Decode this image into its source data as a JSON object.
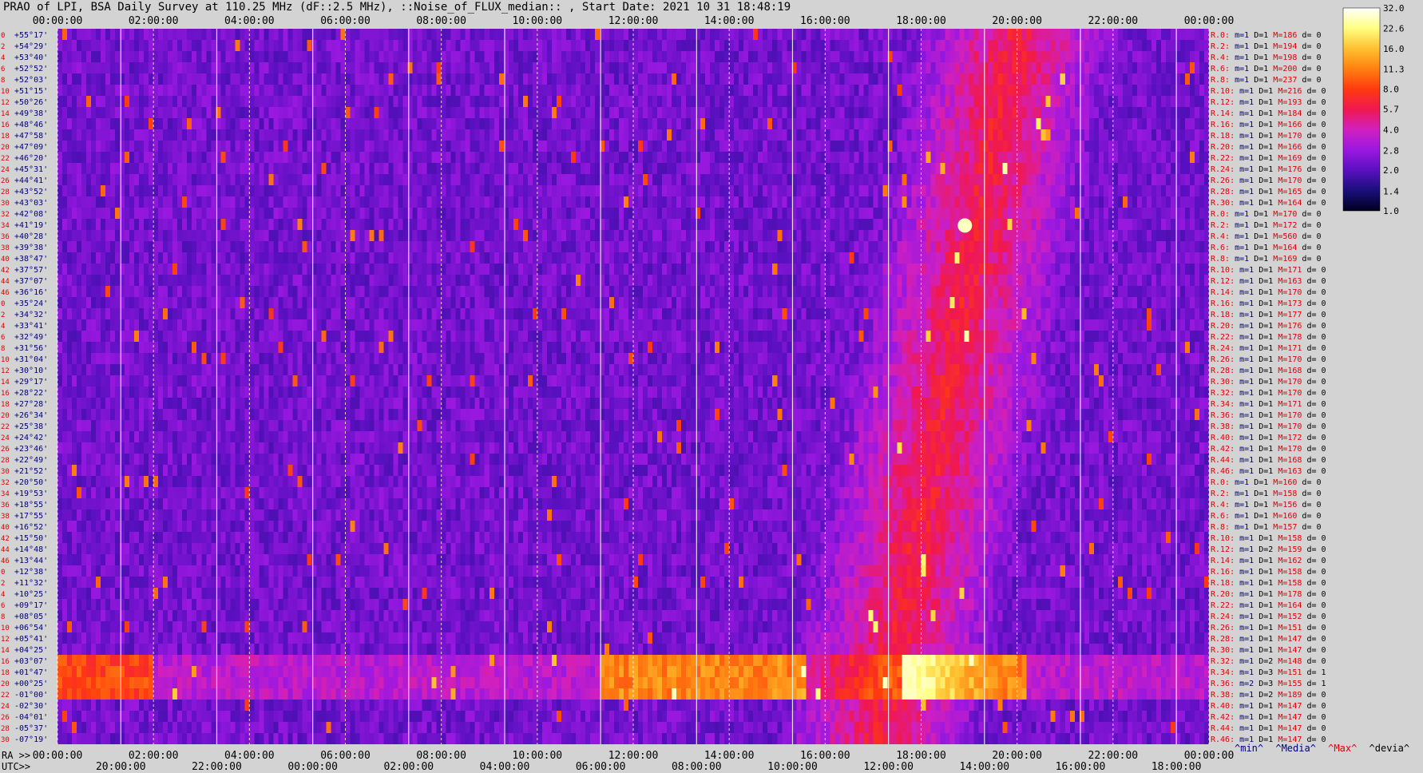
{
  "title": "PRAO of LPI, BSA Daily Survey at 110.25 MHz (dF::2.5 MHz), ::Noise_of_FLUX_median:: , Start Date: 2021 10 31 18:48:19",
  "axis_labels": {
    "ra": "RA >>",
    "utc": "UTC>>"
  },
  "footer_legend": {
    "min": "^min^",
    "median": "^Media^",
    "max": "^Max^",
    "devia": "^devia^"
  },
  "colors": {
    "background": "#d3d3d3",
    "right_label_red": "#e00000",
    "right_label_blue": "#00007a"
  },
  "chart_data": {
    "type": "heatmap",
    "top_x_ticks": [
      "00:00:00",
      "02:00:00",
      "04:00:00",
      "06:00:00",
      "08:00:00",
      "10:00:00",
      "12:00:00",
      "14:00:00",
      "16:00:00",
      "18:00:00",
      "20:00:00",
      "22:00:00",
      "00:00:00"
    ],
    "ra_ticks": [
      "00:00:00",
      "02:00:00",
      "04:00:00",
      "06:00:00",
      "08:00:00",
      "10:00:00",
      "12:00:00",
      "14:00:00",
      "16:00:00",
      "18:00:00",
      "20:00:00",
      "22:00:00",
      "00:00:00"
    ],
    "utc_ticks": [
      "20:00:00",
      "22:00:00",
      "00:00:00",
      "02:00:00",
      "04:00:00",
      "06:00:00",
      "08:00:00",
      "10:00:00",
      "12:00:00",
      "14:00:00",
      "16:00:00",
      "18:00:00"
    ],
    "row_numbers": [
      "0",
      "2",
      "4",
      "6",
      "8",
      "10",
      "12",
      "14",
      "16",
      "18",
      "20",
      "22",
      "24",
      "26",
      "28",
      "30",
      "32",
      "34",
      "36",
      "38",
      "40",
      "42",
      "44",
      "46",
      "0",
      "2",
      "4",
      "6",
      "8",
      "10",
      "12",
      "14",
      "16",
      "18",
      "20",
      "22",
      "24",
      "26",
      "28",
      "30",
      "32",
      "34",
      "36",
      "38",
      "40",
      "42",
      "44",
      "46",
      "0",
      "2",
      "4",
      "6",
      "8",
      "10",
      "12",
      "14",
      "16",
      "18",
      "20",
      "22",
      "24",
      "26",
      "28",
      "30",
      "32",
      "34",
      "36",
      "38",
      "40",
      "42",
      "44",
      "46"
    ],
    "declinations": [
      "+55°17'",
      "+54°29'",
      "+53°40'",
      "+52°52'",
      "+52°03'",
      "+51°15'",
      "+50°26'",
      "+49°38'",
      "+48°46'",
      "+47°58'",
      "+47°09'",
      "+46°20'",
      "+45°31'",
      "+44°41'",
      "+43°52'",
      "+43°03'",
      "+42°08'",
      "+41°19'",
      "+40°28'",
      "+39°38'",
      "+38°47'",
      "+37°57'",
      "+37°07'",
      "+36°16'",
      "+35°24'",
      "+34°32'",
      "+33°41'",
      "+32°49'",
      "+31°56'",
      "+31°04'",
      "+30°10'",
      "+29°17'",
      "+28°22'",
      "+27°28'",
      "+26°34'",
      "+25°38'",
      "+24°42'",
      "+23°46'",
      "+22°49'",
      "+21°52'",
      "+20°50'",
      "+19°53'",
      "+18°55'",
      "+17°55'",
      "+16°52'",
      "+15°50'",
      "+14°48'",
      "+13°44'",
      "+12°38'",
      "+11°32'",
      "+10°25'",
      "+09°17'",
      "+08°05'",
      "+06°54'",
      "+05°41'",
      "+04°25'",
      "+03°07'",
      "+01°47'",
      "+00°25'",
      "-01°00'",
      "-02°30'",
      "-04°01'",
      "-05°37'",
      "-07°19'"
    ],
    "right_labels": [
      {
        "r": "R.0:",
        "m": "m=1",
        "d": "D=1",
        "mm": "M=186",
        "dd": "d= 0"
      },
      {
        "r": "R.2:",
        "m": "m=1",
        "d": "D=1",
        "mm": "M=194",
        "dd": "d= 0"
      },
      {
        "r": "R.4:",
        "m": "m=1",
        "d": "D=1",
        "mm": "M=198",
        "dd": "d= 0"
      },
      {
        "r": "R.6:",
        "m": "m=1",
        "d": "D=1",
        "mm": "M=200",
        "dd": "d= 0"
      },
      {
        "r": "R.8:",
        "m": "m=1",
        "d": "D=1",
        "mm": "M=237",
        "dd": "d= 0"
      },
      {
        "r": "R.10:",
        "m": "m=1",
        "d": "D=1",
        "mm": "M=216",
        "dd": "d= 0"
      },
      {
        "r": "R.12:",
        "m": "m=1",
        "d": "D=1",
        "mm": "M=193",
        "dd": "d= 0"
      },
      {
        "r": "R.14:",
        "m": "m=1",
        "d": "D=1",
        "mm": "M=184",
        "dd": "d= 0"
      },
      {
        "r": "R.16:",
        "m": "m=1",
        "d": "D=1",
        "mm": "M=166",
        "dd": "d= 0"
      },
      {
        "r": "R.18:",
        "m": "m=1",
        "d": "D=1",
        "mm": "M=170",
        "dd": "d= 0"
      },
      {
        "r": "R.20:",
        "m": "m=1",
        "d": "D=1",
        "mm": "M=166",
        "dd": "d= 0"
      },
      {
        "r": "R.22:",
        "m": "m=1",
        "d": "D=1",
        "mm": "M=169",
        "dd": "d= 0"
      },
      {
        "r": "R.24:",
        "m": "m=1",
        "d": "D=1",
        "mm": "M=176",
        "dd": "d= 0"
      },
      {
        "r": "R.26:",
        "m": "m=1",
        "d": "D=1",
        "mm": "M=170",
        "dd": "d= 0"
      },
      {
        "r": "R.28:",
        "m": "m=1",
        "d": "D=1",
        "mm": "M=165",
        "dd": "d= 0"
      },
      {
        "r": "R.30:",
        "m": "m=1",
        "d": "D=1",
        "mm": "M=164",
        "dd": "d= 0"
      },
      {
        "r": "R.0:",
        "m": "m=1",
        "d": "D=1",
        "mm": "M=170",
        "dd": "d= 0"
      },
      {
        "r": "R.2:",
        "m": "m=1",
        "d": "D=1",
        "mm": "M=172",
        "dd": "d= 0"
      },
      {
        "r": "R.4:",
        "m": "m=1",
        "d": "D=1",
        "mm": "M=560",
        "dd": "d= 0"
      },
      {
        "r": "R.6:",
        "m": "m=1",
        "d": "D=1",
        "mm": "M=164",
        "dd": "d= 0"
      },
      {
        "r": "R.8:",
        "m": "m=1",
        "d": "D=1",
        "mm": "M=169",
        "dd": "d= 0"
      },
      {
        "r": "R.10:",
        "m": "m=1",
        "d": "D=1",
        "mm": "M=171",
        "dd": "d= 0"
      },
      {
        "r": "R.12:",
        "m": "m=1",
        "d": "D=1",
        "mm": "M=163",
        "dd": "d= 0"
      },
      {
        "r": "R.14:",
        "m": "m=1",
        "d": "D=1",
        "mm": "M=170",
        "dd": "d= 0"
      },
      {
        "r": "R.16:",
        "m": "m=1",
        "d": "D=1",
        "mm": "M=173",
        "dd": "d= 0"
      },
      {
        "r": "R.18:",
        "m": "m=1",
        "d": "D=1",
        "mm": "M=177",
        "dd": "d= 0"
      },
      {
        "r": "R.20:",
        "m": "m=1",
        "d": "D=1",
        "mm": "M=176",
        "dd": "d= 0"
      },
      {
        "r": "R.22:",
        "m": "m=1",
        "d": "D=1",
        "mm": "M=178",
        "dd": "d= 0"
      },
      {
        "r": "R.24:",
        "m": "m=1",
        "d": "D=1",
        "mm": "M=171",
        "dd": "d= 0"
      },
      {
        "r": "R.26:",
        "m": "m=1",
        "d": "D=1",
        "mm": "M=170",
        "dd": "d= 0"
      },
      {
        "r": "R.28:",
        "m": "m=1",
        "d": "D=1",
        "mm": "M=168",
        "dd": "d= 0"
      },
      {
        "r": "R.30:",
        "m": "m=1",
        "d": "D=1",
        "mm": "M=170",
        "dd": "d= 0"
      },
      {
        "r": "R.32:",
        "m": "m=1",
        "d": "D=1",
        "mm": "M=170",
        "dd": "d= 0"
      },
      {
        "r": "R.34:",
        "m": "m=1",
        "d": "D=1",
        "mm": "M=171",
        "dd": "d= 0"
      },
      {
        "r": "R.36:",
        "m": "m=1",
        "d": "D=1",
        "mm": "M=170",
        "dd": "d= 0"
      },
      {
        "r": "R.38:",
        "m": "m=1",
        "d": "D=1",
        "mm": "M=170",
        "dd": "d= 0"
      },
      {
        "r": "R.40:",
        "m": "m=1",
        "d": "D=1",
        "mm": "M=172",
        "dd": "d= 0"
      },
      {
        "r": "R.42:",
        "m": "m=1",
        "d": "D=1",
        "mm": "M=170",
        "dd": "d= 0"
      },
      {
        "r": "R.44:",
        "m": "m=1",
        "d": "D=1",
        "mm": "M=168",
        "dd": "d= 0"
      },
      {
        "r": "R.46:",
        "m": "m=1",
        "d": "D=1",
        "mm": "M=163",
        "dd": "d= 0"
      },
      {
        "r": "R.0:",
        "m": "m=1",
        "d": "D=1",
        "mm": "M=160",
        "dd": "d= 0"
      },
      {
        "r": "R.2:",
        "m": "m=1",
        "d": "D=1",
        "mm": "M=158",
        "dd": "d= 0"
      },
      {
        "r": "R.4:",
        "m": "m=1",
        "d": "D=1",
        "mm": "M=156",
        "dd": "d= 0"
      },
      {
        "r": "R.6:",
        "m": "m=1",
        "d": "D=1",
        "mm": "M=160",
        "dd": "d= 0"
      },
      {
        "r": "R.8:",
        "m": "m=1",
        "d": "D=1",
        "mm": "M=157",
        "dd": "d= 0"
      },
      {
        "r": "R.10:",
        "m": "m=1",
        "d": "D=1",
        "mm": "M=158",
        "dd": "d= 0"
      },
      {
        "r": "R.12:",
        "m": "m=1",
        "d": "D=2",
        "mm": "M=159",
        "dd": "d= 0"
      },
      {
        "r": "R.14:",
        "m": "m=1",
        "d": "D=1",
        "mm": "M=162",
        "dd": "d= 0"
      },
      {
        "r": "R.16:",
        "m": "m=1",
        "d": "D=1",
        "mm": "M=158",
        "dd": "d= 0"
      },
      {
        "r": "R.18:",
        "m": "m=1",
        "d": "D=1",
        "mm": "M=158",
        "dd": "d= 0"
      },
      {
        "r": "R.20:",
        "m": "m=1",
        "d": "D=1",
        "mm": "M=178",
        "dd": "d= 0"
      },
      {
        "r": "R.22:",
        "m": "m=1",
        "d": "D=1",
        "mm": "M=164",
        "dd": "d= 0"
      },
      {
        "r": "R.24:",
        "m": "m=1",
        "d": "D=1",
        "mm": "M=152",
        "dd": "d= 0"
      },
      {
        "r": "R.26:",
        "m": "m=1",
        "d": "D=1",
        "mm": "M=151",
        "dd": "d= 0"
      },
      {
        "r": "R.28:",
        "m": "m=1",
        "d": "D=1",
        "mm": "M=147",
        "dd": "d= 0"
      },
      {
        "r": "R.30:",
        "m": "m=1",
        "d": "D=1",
        "mm": "M=147",
        "dd": "d= 0"
      },
      {
        "r": "R.32:",
        "m": "m=1",
        "d": "D=2",
        "mm": "M=148",
        "dd": "d= 0"
      },
      {
        "r": "R.34:",
        "m": "m=1",
        "d": "D=3",
        "mm": "M=151",
        "dd": "d= 1"
      },
      {
        "r": "R.36:",
        "m": "m=2",
        "d": "D=3",
        "mm": "M=155",
        "dd": "d= 1"
      },
      {
        "r": "R.38:",
        "m": "m=1",
        "d": "D=2",
        "mm": "M=189",
        "dd": "d= 0"
      },
      {
        "r": "R.40:",
        "m": "m=1",
        "d": "D=1",
        "mm": "M=147",
        "dd": "d= 0"
      },
      {
        "r": "R.42:",
        "m": "m=1",
        "d": "D=1",
        "mm": "M=147",
        "dd": "d= 0"
      },
      {
        "r": "R.44:",
        "m": "m=1",
        "d": "D=1",
        "mm": "M=147",
        "dd": "d= 0"
      },
      {
        "r": "R.46:",
        "m": "m=1",
        "d": "D=1",
        "mm": "M=147",
        "dd": "d= 0"
      }
    ],
    "colorbar": {
      "ticks": [
        "32.0",
        "22.6",
        "16.0",
        "11.3",
        "8.0",
        "5.7",
        "4.0",
        "2.8",
        "2.0",
        "1.4",
        "1.0"
      ],
      "range": [
        1.0,
        32.0
      ],
      "scale": "log",
      "colors": [
        "#000020",
        "#1a0f7a",
        "#5a10c0",
        "#9a18e0",
        "#d020c0",
        "#f01850",
        "#ff3a10",
        "#ff8010",
        "#ffc030",
        "#ffff80",
        "#ffffff"
      ]
    }
  }
}
